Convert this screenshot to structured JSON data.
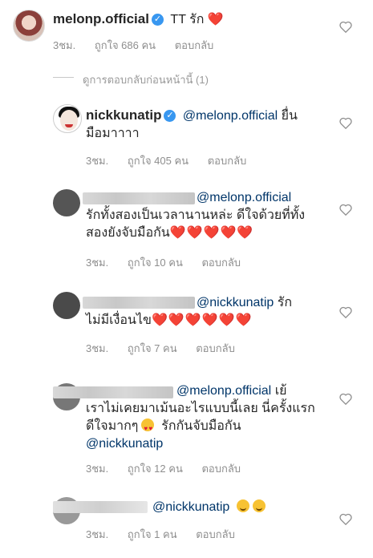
{
  "main_comment": {
    "username": "melonp.official",
    "text": "TT รัก",
    "heart": "❤️",
    "time": "3ชม.",
    "likes": "ถูกใจ 686 คน",
    "reply": "ตอบกลับ"
  },
  "view_previous": "ดูการตอบกลับก่อนหน้านี้ (1)",
  "replies": [
    {
      "username": "nickkunatip",
      "mention": "@melonp.official",
      "text_line1": "ยื่น",
      "text_line2": "มือมาาาา",
      "time": "3ชม.",
      "likes": "ถูกใจ 405 คน",
      "reply": "ตอบกลับ"
    },
    {
      "mention": "@melonp.official",
      "text_line1": "รักทั้งสองเป็นเวลานานหล่ะ ดีใจด้วยที่ทั้ง",
      "text_line2": "สองยังจับมือกัน",
      "hearts": "❤️❤️❤️❤️❤️",
      "time": "3ชม.",
      "likes": "ถูกใจ 10 คน",
      "reply": "ตอบกลับ"
    },
    {
      "mention": "@nickkunatip",
      "text_line1": "รัก",
      "text_line2": "ไม่มีเงื่อนไข",
      "hearts": "❤️❤️❤️❤️❤️❤️",
      "time": "3ชม.",
      "likes": "ถูกใจ 7 คน",
      "reply": "ตอบกลับ"
    },
    {
      "mention": "@melonp.official",
      "text_line1": "เย้",
      "text_line2": "เราไม่เคยมาเม้นอะไรแบบนี้เลย นี่ครั้งแรก",
      "text_line3a": "ดีใจมากๆ",
      "text_line3b": "รักกันจับมือกัน",
      "mention2": "@nickkunatip",
      "time": "3ชม.",
      "likes": "ถูกใจ 12 คน",
      "reply": "ตอบกลับ"
    },
    {
      "mention": "@nickkunatip",
      "time": "3ชม.",
      "likes": "ถูกใจ 1 คน",
      "reply": "ตอบกลับ"
    }
  ],
  "icons": {
    "like": "heart-outline-icon",
    "verified": "verified-badge-icon"
  },
  "colors": {
    "mention": "#003569",
    "verified": "#3897f0",
    "heart": "#e0143b",
    "meta": "#8e8e8e"
  }
}
